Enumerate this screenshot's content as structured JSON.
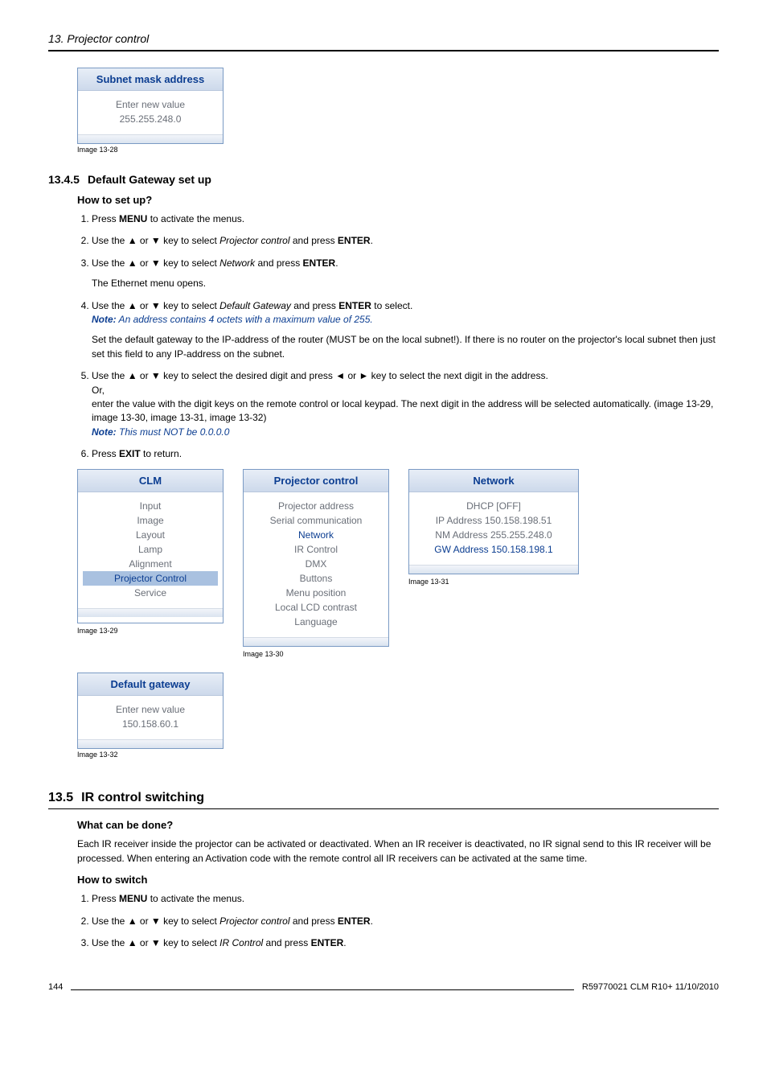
{
  "chapter": "13. Projector control",
  "fig28": {
    "title": "Subnet mask address",
    "line1": "Enter new value",
    "line2": "255.255.248.0",
    "caption": "Image 13-28"
  },
  "sec1345": {
    "num": "13.4.5",
    "title": "Default Gateway set up",
    "howto": "How to set up?",
    "step1a": "Press ",
    "step1b": "MENU",
    "step1c": " to activate the menus.",
    "step2a": "Use the ▲ or ▼ key to select ",
    "step2b": "Projector control",
    "step2c": " and press ",
    "step2d": "ENTER",
    "step2e": ".",
    "step3a": "Use the ▲ or ▼ key to select ",
    "step3b": "Network",
    "step3c": " and press ",
    "step3d": "ENTER",
    "step3e": ".",
    "step3note": "The Ethernet menu opens.",
    "step4a": "Use the ▲ or ▼ key to select ",
    "step4b": "Default Gateway",
    "step4c": " and press ",
    "step4d": "ENTER",
    "step4e": " to select.",
    "step4noteLabel": "Note:",
    "step4note": "   An address contains 4 octets with a maximum value of 255.",
    "step4para": "Set the default gateway to the IP-address of the router (MUST be on the local subnet!). If there is no router on the projector's local subnet then just set this field to any IP-address on the subnet.",
    "step5a": "Use the ▲ or ▼ key to select the desired digit and press ◄ or ► key to select the next digit in the address.",
    "step5or": "Or,",
    "step5b": "enter the value with the digit keys on the remote control or local keypad. The next digit in the address will be selected automatically. (image 13-29, image 13-30, image 13-31, image 13-32)",
    "step5noteLabel": "Note:",
    "step5note": "   This must NOT be 0.0.0.0",
    "step6a": "Press ",
    "step6b": "EXIT",
    "step6c": " to return."
  },
  "fig29": {
    "title": "CLM",
    "items": [
      "Input",
      "Image",
      "Layout",
      "Lamp",
      "Alignment",
      "Projector Control",
      "Service"
    ],
    "selectedIndex": 5,
    "caption": "Image 13-29"
  },
  "fig30": {
    "title": "Projector control",
    "items": [
      "Projector address",
      "Serial communication",
      "Network",
      "IR Control",
      "DMX",
      "Buttons",
      "Menu position",
      "Local LCD contrast",
      "Language"
    ],
    "blueIndex": 2,
    "caption": "Image 13-30"
  },
  "fig31": {
    "title": "Network",
    "items": [
      "DHCP [OFF]",
      "IP Address 150.158.198.51",
      "NM Address 255.255.248.0",
      "GW Address 150.158.198.1"
    ],
    "blueIndex": 3,
    "caption": "Image 13-31"
  },
  "fig32": {
    "title": "Default gateway",
    "line1": "Enter new value",
    "line2": "150.158.60.1",
    "caption": "Image 13-32"
  },
  "sec135": {
    "num": "13.5",
    "title": "IR control switching",
    "q1": "What can be done?",
    "p1": "Each IR receiver inside the projector can be activated or deactivated. When an IR receiver is deactivated, no IR signal send to this IR receiver will be processed. When entering an Activation code with the remote control all IR receivers can be activated at the same time.",
    "q2": "How to switch",
    "step1a": "Press ",
    "step1b": "MENU",
    "step1c": " to activate the menus.",
    "step2a": "Use the ▲ or ▼ key to select ",
    "step2b": "Projector control",
    "step2c": " and press ",
    "step2d": "ENTER",
    "step2e": ".",
    "step3a": "Use the ▲ or ▼ key to select ",
    "step3b": "IR Control",
    "step3c": " and press ",
    "step3d": "ENTER",
    "step3e": "."
  },
  "footer": {
    "page": "144",
    "doc": "R59770021  CLM R10+  11/10/2010"
  }
}
